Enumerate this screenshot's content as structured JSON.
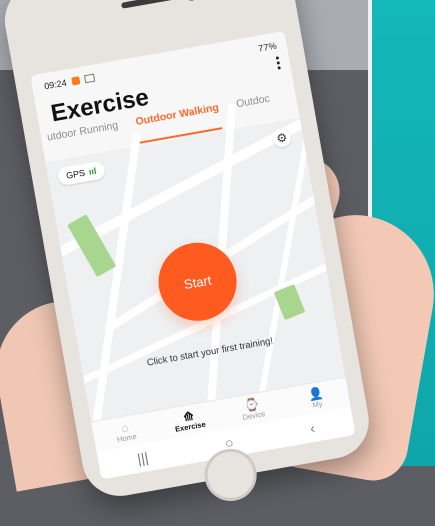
{
  "app": {
    "status": {
      "time": "09:24",
      "right": "77%"
    },
    "title": "Exercise",
    "tabs": [
      {
        "label": "utdoor Running",
        "active": false
      },
      {
        "label": "Outdoor Walking",
        "active": true
      },
      {
        "label": "Outdoc",
        "active": false
      }
    ],
    "map": {
      "gps_label": "GPS",
      "gps_strength": "ııl",
      "settings_icon": "settings-icon"
    },
    "start": {
      "label": "Start"
    },
    "hint": "Click to start your first training!",
    "nav": [
      {
        "label": "Home",
        "icon": "home-icon",
        "active": false
      },
      {
        "label": "Exercise",
        "icon": "run-icon",
        "active": true
      },
      {
        "label": "Device",
        "icon": "watch-icon",
        "active": false
      },
      {
        "label": "My",
        "icon": "user-icon",
        "active": false
      }
    ],
    "system_nav": {
      "recent": "|||",
      "home": "○",
      "back": "‹"
    }
  },
  "colors": {
    "accent": "#ff5a1f",
    "teal": "#13b8b8"
  }
}
